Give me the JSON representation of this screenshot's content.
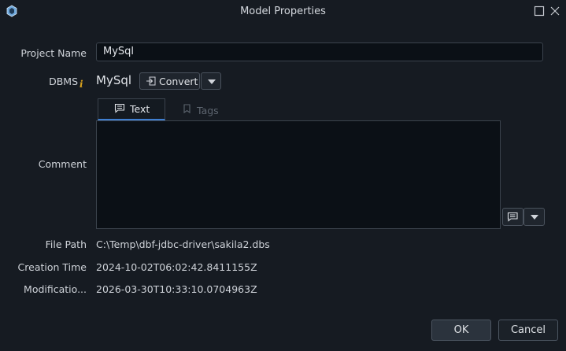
{
  "window": {
    "title": "Model Properties"
  },
  "form": {
    "project_name_label": "Project Name",
    "project_name_value": "MySql",
    "dbms_label": "DBMS",
    "dbms_value": "MySql",
    "convert_label": "Convert",
    "tabs": [
      {
        "label": "Text",
        "selected": true
      },
      {
        "label": "Tags",
        "selected": false
      }
    ],
    "comment_label": "Comment",
    "comment_value": "",
    "file_path_label": "File Path",
    "file_path_value": "C:\\Temp\\dbf-jdbc-driver\\sakila2.dbs",
    "creation_time_label": "Creation Time",
    "creation_time_value": "2024-10-02T06:02:42.8411155Z",
    "modification_label": "Modificatio...",
    "modification_value": "2026-03-30T10:33:10.0704963Z"
  },
  "footer": {
    "ok_label": "OK",
    "cancel_label": "Cancel"
  },
  "colors": {
    "background": "#161b22",
    "accent": "#3f7fd1",
    "info_icon": "#d9a21e"
  }
}
